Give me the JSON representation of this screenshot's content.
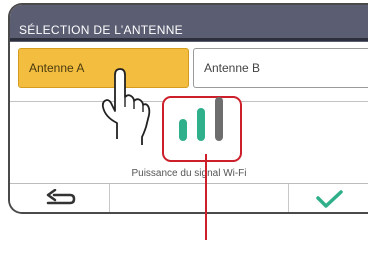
{
  "header": {
    "title": "SÉLECTION DE L’ANTENNE"
  },
  "antenna_buttons": [
    {
      "label": "Antenne A",
      "selected": true
    },
    {
      "label": "Antenne B",
      "selected": false
    }
  ],
  "signal": {
    "label": "Puissance du signal Wi-Fi",
    "bars_total": 3,
    "bars_lit": 2,
    "active_color": "#2fb08a",
    "inactive_color": "#6e6e6e"
  },
  "footer": {
    "back_icon": "return-arrow-icon",
    "confirm_icon": "checkmark-icon"
  },
  "colors": {
    "header": "#5b5d72",
    "selected_button": "#f3be3f",
    "callout_red": "#cc1f2a",
    "confirm_green": "#2fb08a"
  }
}
